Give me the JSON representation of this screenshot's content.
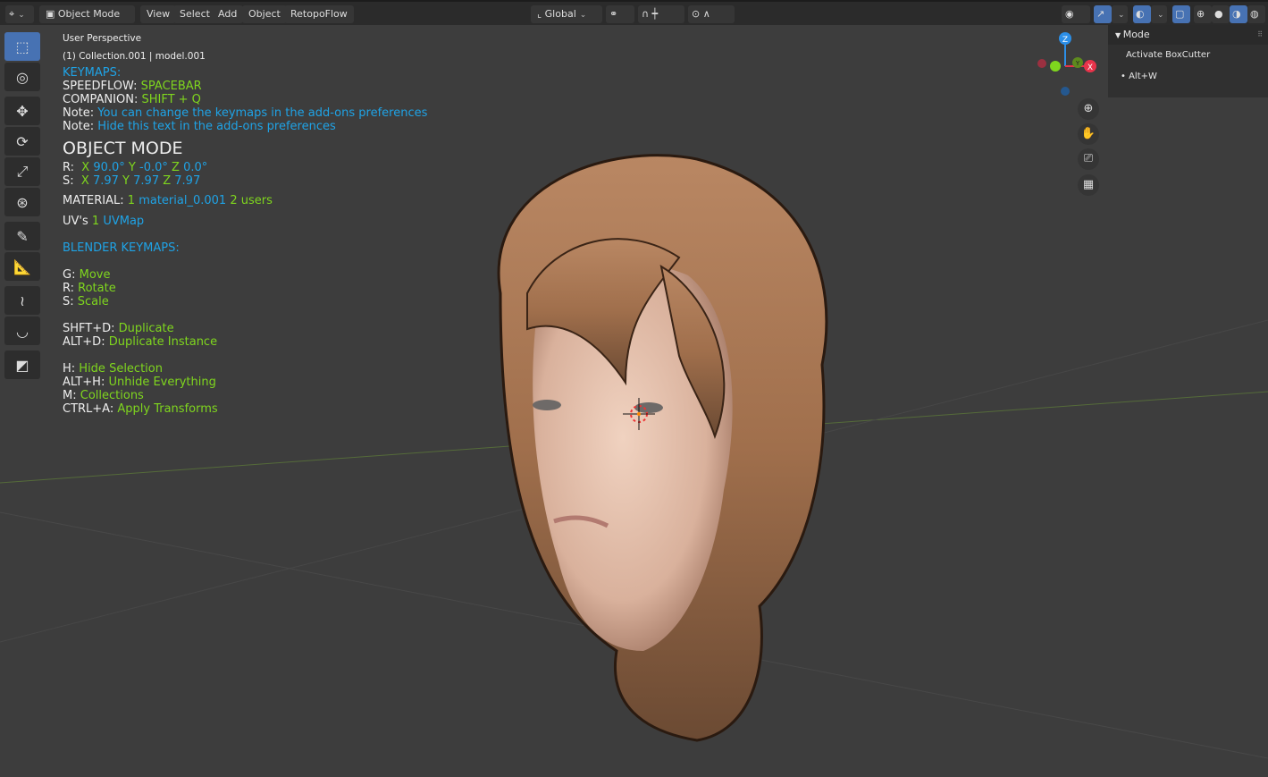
{
  "header": {
    "mode": "Object Mode",
    "menus": [
      "View",
      "Select",
      "Add",
      "Object",
      "RetopoFlow"
    ],
    "orientation": "Global"
  },
  "overlay": {
    "view_name": "User Perspective",
    "collection": "(1) Collection.001 | model.001"
  },
  "info": {
    "keymaps_title": "KEYMAPS:",
    "speedflow_label": "SPEEDFLOW:",
    "speedflow_key": "SPACEBAR",
    "companion_label": "COMPANION:",
    "companion_key": "SHIFT + Q",
    "note_label": "Note:",
    "note1": "You can change the keymaps in the add-ons preferences",
    "note2": "Hide this text in the add-ons preferences",
    "mode_title": "OBJECT MODE",
    "rotation": {
      "label": "R:",
      "x": "90.0°",
      "y": "-0.0°",
      "z": "0.0°"
    },
    "scale": {
      "label": "S:",
      "x": "7.97",
      "y": "7.97",
      "z": "7.97"
    },
    "material": {
      "label": "MATERIAL:",
      "count": "1",
      "name": "material_0.001",
      "users": "2 users"
    },
    "uv": {
      "label": "UV's",
      "count": "1",
      "name": "UVMap"
    },
    "blender_keymaps_title": "BLENDER KEYMAPS:",
    "keys": [
      {
        "key": "G:",
        "action": "Move"
      },
      {
        "key": "R:",
        "action": "Rotate"
      },
      {
        "key": "S:",
        "action": "Scale"
      },
      {
        "key": "SHFT+D:",
        "action": "Duplicate"
      },
      {
        "key": "ALT+D:",
        "action": "Duplicate Instance"
      },
      {
        "key": "H:",
        "action": "Hide Selection"
      },
      {
        "key": "ALT+H:",
        "action": "Unhide Everything"
      },
      {
        "key": "M:",
        "action": "Collections"
      },
      {
        "key": "CTRL+A:",
        "action": "Apply Transforms"
      }
    ]
  },
  "side_panel": {
    "title": "Mode",
    "item": "Activate BoxCutter",
    "shortcut": "• Alt+W"
  },
  "gizmo": {
    "x": "X",
    "y": "Y",
    "z": "Z"
  },
  "colors": {
    "accent": "#4772b3",
    "green": "#7fd61e",
    "blue": "#1fa3e6",
    "x_axis": "#e8334a",
    "y_axis": "#7fd61e",
    "z_axis": "#2c8fe8"
  }
}
